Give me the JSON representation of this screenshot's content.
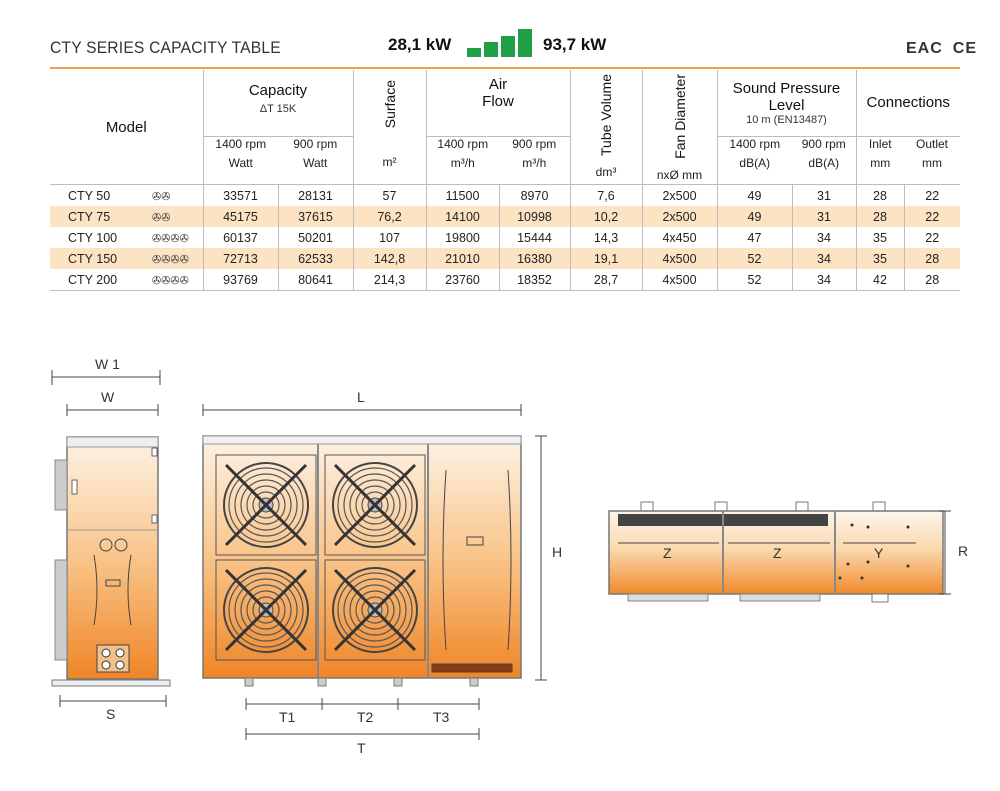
{
  "header": {
    "title": "CTY SERIES CAPACITY TABLE",
    "range_min": "28,1 kW",
    "range_max": "93,7  kW",
    "certifications": [
      "EAC",
      "CE"
    ],
    "accent_color": "#f0a14a",
    "bars_color": "#1fa045"
  },
  "table": {
    "model_header": "Model",
    "capacity": {
      "title": "Capacity",
      "sub": "ΔT  15K",
      "col1_rpm": "1400 rpm",
      "col2_rpm": "900 rpm",
      "col1_unit": "Watt",
      "col2_unit": "Watt"
    },
    "surface": {
      "title": "Surface",
      "unit": "m²"
    },
    "airflow": {
      "title1": "Air",
      "title2": "Flow",
      "col1_rpm": "1400 rpm",
      "col2_rpm": "900 rpm",
      "col1_unit": "m³/h",
      "col2_unit": "m³/h"
    },
    "tube": {
      "title": "Tube Volume",
      "unit": "dm³"
    },
    "fan": {
      "title": "Fan Diameter",
      "unit": "nxØ mm"
    },
    "sound": {
      "title1": "Sound Pressure",
      "title2": "Level",
      "sub": "10 m (EN13487)",
      "col1_rpm": "1400 rpm",
      "col2_rpm": "900 rpm",
      "col1_unit": "dB(A)",
      "col2_unit": "dB(A)"
    },
    "connections": {
      "title": "Connections",
      "col1": "Inlet",
      "col2": "Outlet",
      "col1_unit": "mm",
      "col2_unit": "mm"
    },
    "rows": [
      {
        "model": "CTY 50",
        "fans": "✇✇",
        "cap1400": "33571",
        "cap900": "28131",
        "surface": "57",
        "air1400": "11500",
        "air900": "8970",
        "tube": "7,6",
        "fan": "2x500",
        "snd1400": "49",
        "snd900": "31",
        "inlet": "28",
        "outlet": "22"
      },
      {
        "model": "CTY 75",
        "fans": "✇✇",
        "cap1400": "45175",
        "cap900": "37615",
        "surface": "76,2",
        "air1400": "14100",
        "air900": "10998",
        "tube": "10,2",
        "fan": "2x500",
        "snd1400": "49",
        "snd900": "31",
        "inlet": "28",
        "outlet": "22"
      },
      {
        "model": "CTY 100",
        "fans": "✇✇✇✇",
        "cap1400": "60137",
        "cap900": "50201",
        "surface": "107",
        "air1400": "19800",
        "air900": "15444",
        "tube": "14,3",
        "fan": "4x450",
        "snd1400": "47",
        "snd900": "34",
        "inlet": "35",
        "outlet": "22"
      },
      {
        "model": "CTY 150",
        "fans": "✇✇✇✇",
        "cap1400": "72713",
        "cap900": "62533",
        "surface": "142,8",
        "air1400": "21010",
        "air900": "16380",
        "tube": "19,1",
        "fan": "4x500",
        "snd1400": "52",
        "snd900": "34",
        "inlet": "35",
        "outlet": "28"
      },
      {
        "model": "CTY 200",
        "fans": "✇✇✇✇",
        "cap1400": "93769",
        "cap900": "80641",
        "surface": "214,3",
        "air1400": "23760",
        "air900": "18352",
        "tube": "28,7",
        "fan": "4x500",
        "snd1400": "52",
        "snd900": "34",
        "inlet": "42",
        "outlet": "28"
      }
    ]
  },
  "drawings": {
    "side": {
      "w1": "W 1",
      "w": "W",
      "s": "S"
    },
    "front": {
      "l": "L",
      "h": "H",
      "t1": "T1",
      "t2": "T2",
      "t3": "T3",
      "t": "T"
    },
    "top": {
      "z1": "Z",
      "z2": "Z",
      "y": "Y",
      "r": "R"
    }
  }
}
